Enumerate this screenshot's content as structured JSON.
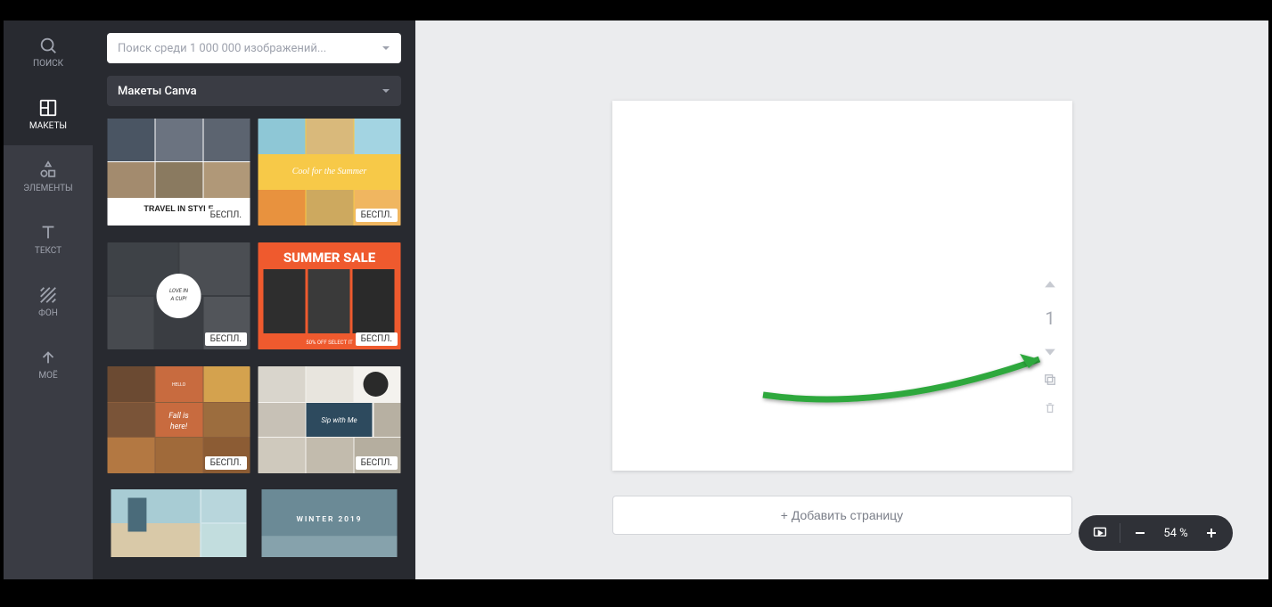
{
  "nav": {
    "search": "ПОИСК",
    "templates": "МАКЕТЫ",
    "elements": "ЭЛЕМЕНТЫ",
    "text": "ТЕКСТ",
    "background": "ФОН",
    "uploads": "МОЁ"
  },
  "panel": {
    "search_placeholder": "Поиск среди 1 000 000 изображений...",
    "category_selected": "Макеты Canva",
    "free_badge": "БЕСПЛ.",
    "tiles": [
      {
        "title": "TRAVEL IN STYLE",
        "subtitle": ""
      },
      {
        "title": "Cool for the Summer",
        "subtitle": ""
      },
      {
        "title": "LOVE IN A CUP!",
        "subtitle": ""
      },
      {
        "title": "SUMMER SALE",
        "subtitle": "50% OFF SELECT IT"
      },
      {
        "title": "Fall is here!",
        "subtitle": "HELLO"
      },
      {
        "title": "Sip with Me",
        "subtitle": ""
      },
      {
        "title": "",
        "subtitle": ""
      },
      {
        "title": "WINTER 2019",
        "subtitle": ""
      }
    ]
  },
  "canvas": {
    "add_page": "+ Добавить страницу",
    "page_number": "1"
  },
  "zoom": {
    "level": "54 %"
  }
}
